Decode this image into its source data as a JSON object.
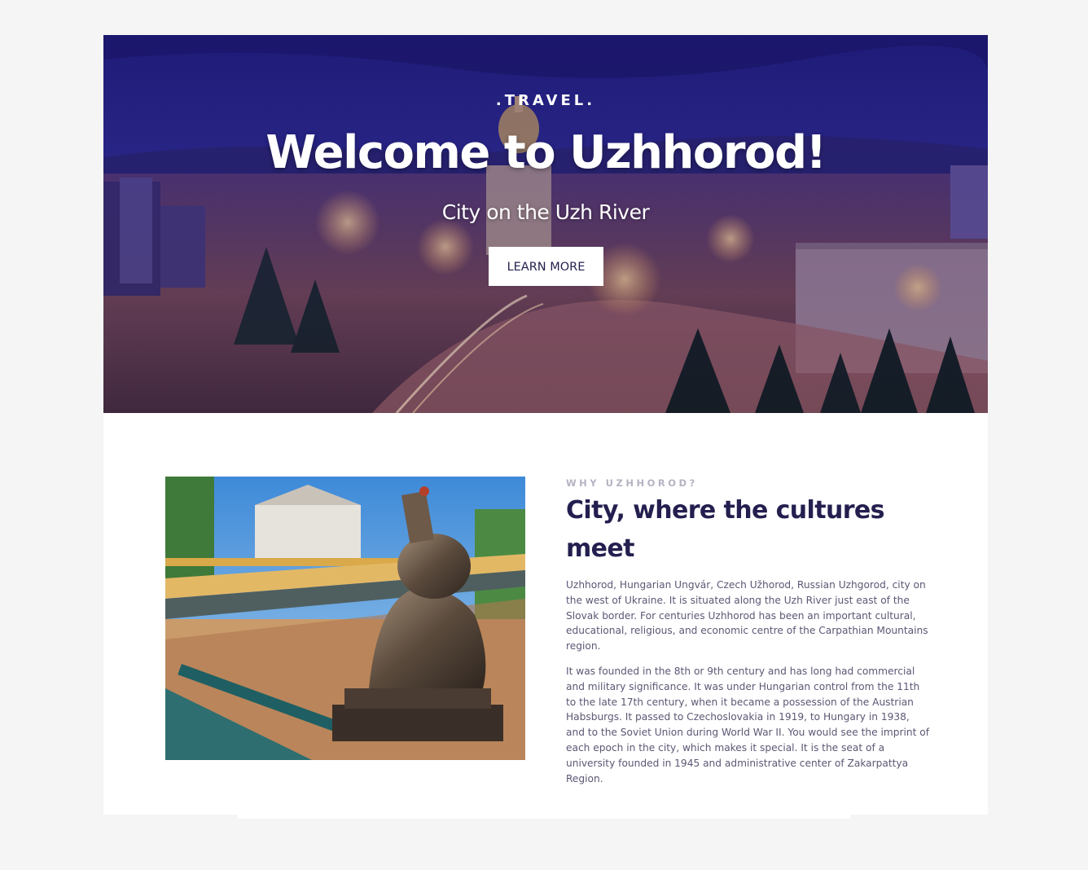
{
  "hero": {
    "kicker": ".TRAVEL.",
    "title": "Welcome to Uzhhorod!",
    "subtitle": "City on the Uzh River",
    "button_label": "LEARN MORE"
  },
  "about": {
    "eyebrow": "WHY UZHHOROD?",
    "title": "City, where the cultures meet",
    "paragraphs": [
      "Uzhhorod, Hungarian Ungvár, Czech Užhorod, Russian Uzhgorod, city on the west of Ukraine. It is situated along the Uzh River just east of the Slovak border. For centuries Uzhhorod has been an important cultural, educational, religious, and economic centre of the Carpathian Mountains region.",
      "It was founded in the 8th or 9th century and has long had commercial and military significance. It was under Hungarian control from the 11th to the late 17th century, when it became a possession of the Austrian Habsburgs. It passed to Czechoslovakia in 1919, to Hungary in 1938, and to the Soviet Union during World War II. You would see the imprint of each epoch in the city, which makes it special. It is the seat of a university founded in 1945 and administrative center of Zakarpattya Region."
    ]
  },
  "colors": {
    "page_background": "#f5f5f5",
    "card_background": "#ffffff",
    "heading": "#231f4f",
    "body_text": "#5b5874",
    "eyebrow": "#b5b3c2",
    "hero_tint": "#2a238c"
  }
}
